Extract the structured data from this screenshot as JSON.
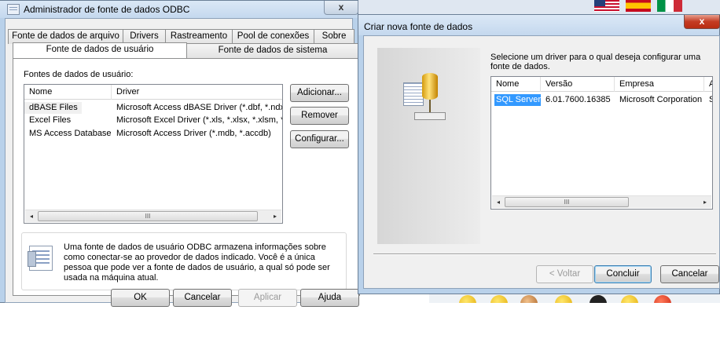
{
  "odbc_window": {
    "title": "Administrador de fonte de dados ODBC",
    "close_label": "x",
    "tabs_back_row": [
      "Fonte de dados de arquivo",
      "Drivers",
      "Rastreamento",
      "Pool de conexões",
      "Sobre"
    ],
    "tabs_front_row": [
      "Fonte de dados de usuário",
      "Fonte de dados de sistema"
    ],
    "section_label": "Fontes de dados de usuário:",
    "list": {
      "columns": [
        "Nome",
        "Driver"
      ],
      "rows": [
        [
          "dBASE Files",
          "Microsoft Access dBASE Driver (*.dbf, *.ndx, *.mdx)"
        ],
        [
          "Excel Files",
          "Microsoft Excel Driver (*.xls, *.xlsx, *.xlsm, *.xlsb)"
        ],
        [
          "MS Access Database",
          "Microsoft Access Driver (*.mdb, *.accdb)"
        ]
      ],
      "scroll_left": "◂",
      "scroll_right": "▸",
      "scroll_grip": "III"
    },
    "side_buttons": [
      "Adicionar...",
      "Remover",
      "Configurar..."
    ],
    "info_text": "Uma fonte de dados de usuário ODBC armazena informações sobre como conectar-se ao provedor de dados indicado. Você é a única pessoa que pode ver a fonte de dados de usuário, a qual só pode ser usada na máquina atual.",
    "bottom_buttons": [
      "OK",
      "Cancelar",
      "Aplicar",
      "Ajuda"
    ]
  },
  "criar_dialog": {
    "title": "Criar nova fonte de dados",
    "close_label": "x",
    "prompt": "Selecione um driver para o qual deseja configurar uma fonte de dados.",
    "columns": [
      "Nome",
      "Versão",
      "Empresa",
      "A"
    ],
    "rows": [
      [
        "SQL Server",
        "6.01.7600.16385",
        "Microsoft Corporation",
        "S"
      ]
    ],
    "scroll_left": "◂",
    "scroll_right": "▸",
    "scroll_grip": "III",
    "buttons": {
      "back": "< Voltar",
      "finish": "Concluir",
      "cancel": "Cancelar"
    }
  },
  "icons": [
    "us-flag-icon",
    "spain-flag-icon",
    "italy-flag-icon",
    "datasource-doc-icon",
    "database-driver-icon"
  ],
  "colors": {
    "titlebar": "#c4d8ee",
    "selection": "#3399ff",
    "close_active": "#c43b23"
  }
}
